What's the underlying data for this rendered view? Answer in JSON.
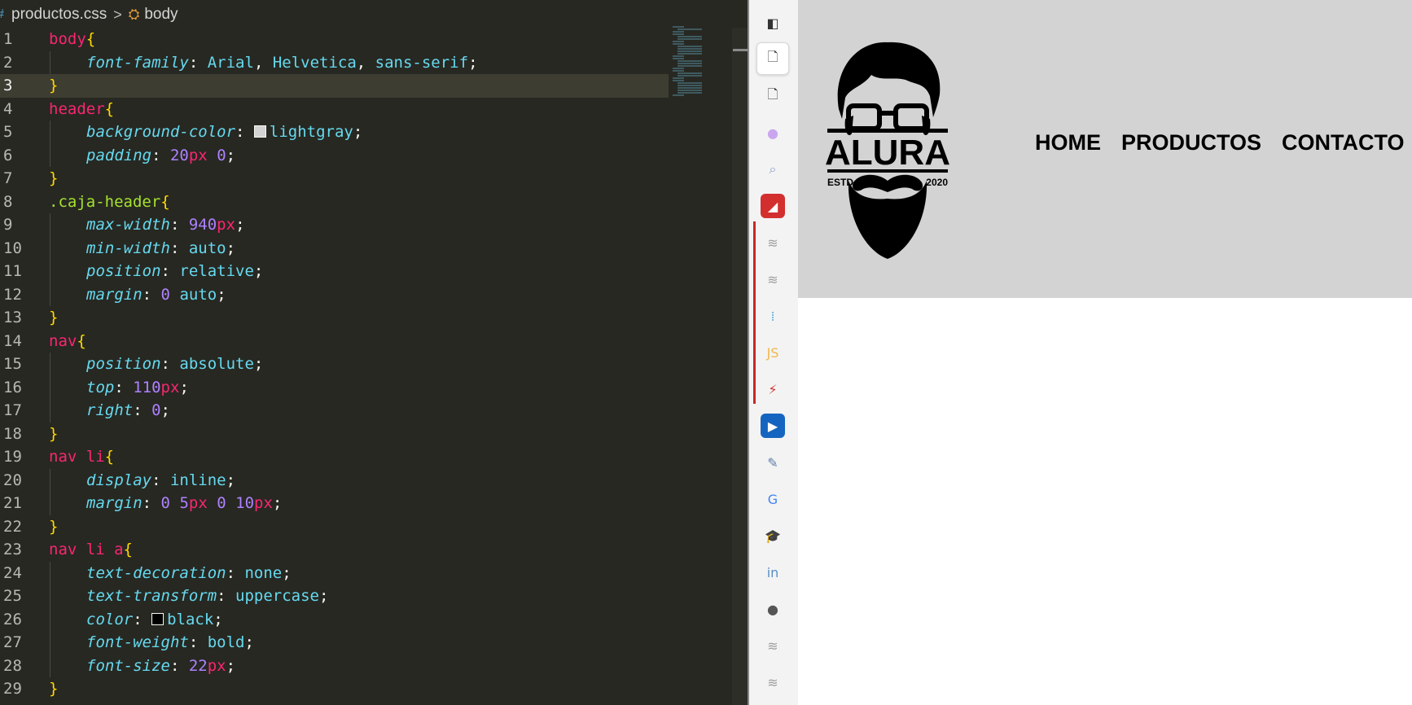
{
  "breadcrumb": {
    "file": "productos.css",
    "separator": ">",
    "symbol": "body"
  },
  "code": [
    {
      "n": "1",
      "tokens": [
        [
          "sel",
          "body"
        ],
        [
          "br",
          "{"
        ]
      ]
    },
    {
      "n": "2",
      "indent": true,
      "tokens": [
        [
          "prop",
          "font-family"
        ],
        [
          "pun",
          ": "
        ],
        [
          "val",
          "Arial"
        ],
        [
          "pun",
          ", "
        ],
        [
          "val",
          "Helvetica"
        ],
        [
          "pun",
          ", "
        ],
        [
          "val",
          "sans-serif"
        ],
        [
          "pun",
          ";"
        ]
      ]
    },
    {
      "n": "3",
      "active": true,
      "tokens": [
        [
          "br",
          "}"
        ]
      ]
    },
    {
      "n": "4",
      "tokens": [
        [
          "sel",
          "header"
        ],
        [
          "br",
          "{"
        ]
      ]
    },
    {
      "n": "5",
      "indent": true,
      "tokens": [
        [
          "prop",
          "background-color"
        ],
        [
          "pun",
          ": "
        ],
        [
          "swatch",
          "#d3d3d3"
        ],
        [
          "val",
          "lightgray"
        ],
        [
          "pun",
          ";"
        ]
      ]
    },
    {
      "n": "6",
      "indent": true,
      "tokens": [
        [
          "prop",
          "padding"
        ],
        [
          "pun",
          ": "
        ],
        [
          "num",
          "20"
        ],
        [
          "unit",
          "px"
        ],
        [
          "pun",
          " "
        ],
        [
          "num",
          "0"
        ],
        [
          "pun",
          ";"
        ]
      ]
    },
    {
      "n": "7",
      "tokens": [
        [
          "br",
          "}"
        ]
      ]
    },
    {
      "n": "8",
      "tokens": [
        [
          "cls",
          ".caja-header"
        ],
        [
          "br",
          "{"
        ]
      ]
    },
    {
      "n": "9",
      "indent": true,
      "tokens": [
        [
          "prop",
          "max-width"
        ],
        [
          "pun",
          ": "
        ],
        [
          "num",
          "940"
        ],
        [
          "unit",
          "px"
        ],
        [
          "pun",
          ";"
        ]
      ]
    },
    {
      "n": "10",
      "indent": true,
      "tokens": [
        [
          "prop",
          "min-width"
        ],
        [
          "pun",
          ": "
        ],
        [
          "val",
          "auto"
        ],
        [
          "pun",
          ";"
        ]
      ]
    },
    {
      "n": "11",
      "indent": true,
      "tokens": [
        [
          "prop",
          "position"
        ],
        [
          "pun",
          ": "
        ],
        [
          "val",
          "relative"
        ],
        [
          "pun",
          ";"
        ]
      ]
    },
    {
      "n": "12",
      "indent": true,
      "tokens": [
        [
          "prop",
          "margin"
        ],
        [
          "pun",
          ": "
        ],
        [
          "num",
          "0"
        ],
        [
          "pun",
          " "
        ],
        [
          "val",
          "auto"
        ],
        [
          "pun",
          ";"
        ]
      ]
    },
    {
      "n": "13",
      "tokens": [
        [
          "br",
          "}"
        ]
      ]
    },
    {
      "n": "14",
      "tokens": [
        [
          "sel",
          "nav"
        ],
        [
          "br",
          "{"
        ]
      ]
    },
    {
      "n": "15",
      "indent": true,
      "tokens": [
        [
          "prop",
          "position"
        ],
        [
          "pun",
          ": "
        ],
        [
          "val",
          "absolute"
        ],
        [
          "pun",
          ";"
        ]
      ]
    },
    {
      "n": "16",
      "indent": true,
      "tokens": [
        [
          "prop",
          "top"
        ],
        [
          "pun",
          ": "
        ],
        [
          "num",
          "110"
        ],
        [
          "unit",
          "px"
        ],
        [
          "pun",
          ";"
        ]
      ]
    },
    {
      "n": "17",
      "indent": true,
      "tokens": [
        [
          "prop",
          "right"
        ],
        [
          "pun",
          ": "
        ],
        [
          "num",
          "0"
        ],
        [
          "pun",
          ";"
        ]
      ]
    },
    {
      "n": "18",
      "tokens": [
        [
          "br",
          "}"
        ]
      ]
    },
    {
      "n": "19",
      "tokens": [
        [
          "sel",
          "nav li"
        ],
        [
          "br",
          "{"
        ]
      ]
    },
    {
      "n": "20",
      "indent": true,
      "tokens": [
        [
          "prop",
          "display"
        ],
        [
          "pun",
          ": "
        ],
        [
          "val",
          "inline"
        ],
        [
          "pun",
          ";"
        ]
      ]
    },
    {
      "n": "21",
      "indent": true,
      "tokens": [
        [
          "prop",
          "margin"
        ],
        [
          "pun",
          ": "
        ],
        [
          "num",
          "0"
        ],
        [
          "pun",
          " "
        ],
        [
          "num",
          "5"
        ],
        [
          "unit",
          "px"
        ],
        [
          "pun",
          " "
        ],
        [
          "num",
          "0"
        ],
        [
          "pun",
          " "
        ],
        [
          "num",
          "10"
        ],
        [
          "unit",
          "px"
        ],
        [
          "pun",
          ";"
        ]
      ]
    },
    {
      "n": "22",
      "tokens": [
        [
          "br",
          "}"
        ]
      ]
    },
    {
      "n": "23",
      "tokens": [
        [
          "sel",
          "nav li a"
        ],
        [
          "br",
          "{"
        ]
      ]
    },
    {
      "n": "24",
      "indent": true,
      "tokens": [
        [
          "prop",
          "text-decoration"
        ],
        [
          "pun",
          ": "
        ],
        [
          "val",
          "none"
        ],
        [
          "pun",
          ";"
        ]
      ]
    },
    {
      "n": "25",
      "indent": true,
      "tokens": [
        [
          "prop",
          "text-transform"
        ],
        [
          "pun",
          ": "
        ],
        [
          "val",
          "uppercase"
        ],
        [
          "pun",
          ";"
        ]
      ]
    },
    {
      "n": "26",
      "indent": true,
      "tokens": [
        [
          "prop",
          "color"
        ],
        [
          "pun",
          ": "
        ],
        [
          "swatch",
          "#000000"
        ],
        [
          "val",
          "black"
        ],
        [
          "pun",
          ";"
        ]
      ]
    },
    {
      "n": "27",
      "indent": true,
      "tokens": [
        [
          "prop",
          "font-weight"
        ],
        [
          "pun",
          ": "
        ],
        [
          "val",
          "bold"
        ],
        [
          "pun",
          ";"
        ]
      ]
    },
    {
      "n": "28",
      "indent": true,
      "tokens": [
        [
          "prop",
          "font-size"
        ],
        [
          "pun",
          ": "
        ],
        [
          "num",
          "22"
        ],
        [
          "unit",
          "px"
        ],
        [
          "pun",
          ";"
        ]
      ]
    },
    {
      "n": "29",
      "tokens": [
        [
          "br",
          "}"
        ]
      ]
    }
  ],
  "sidebar": [
    {
      "name": "layout-toggle-icon",
      "glyph": "◧",
      "color": "#333333"
    },
    {
      "name": "file-icon",
      "glyph": "🗋",
      "color": "#333333",
      "active": true
    },
    {
      "name": "file-outline-icon",
      "glyph": "🗋",
      "color": "#333333"
    },
    {
      "name": "extension-purple-icon",
      "glyph": "●",
      "color": "#c9a6ef"
    },
    {
      "name": "search-icon",
      "glyph": "⌕",
      "color": "#8aa0c8"
    },
    {
      "name": "red-app-icon",
      "glyph": "◢",
      "color": "#ffffff",
      "bg": "#d32f2f"
    },
    {
      "name": "aws-icon-1",
      "glyph": "≋",
      "color": "#9e9e9e"
    },
    {
      "name": "aws-icon-2",
      "glyph": "≋",
      "color": "#9e9e9e"
    },
    {
      "name": "cisco-icon",
      "glyph": "⁞",
      "color": "#5fb0d8"
    },
    {
      "name": "javascript-icon",
      "glyph": "JS",
      "color": "#f0b84a"
    },
    {
      "name": "tower-icon",
      "glyph": "⚡",
      "color": "#d32f2f"
    },
    {
      "name": "play-app-icon",
      "glyph": "▶",
      "color": "#ffffff",
      "bg": "#1565c0"
    },
    {
      "name": "notes-icon",
      "glyph": "✎",
      "color": "#5b7fa8"
    },
    {
      "name": "google-icon",
      "glyph": "G",
      "color": "#4285f4"
    },
    {
      "name": "education-icon",
      "glyph": "🎓",
      "color": "#e0b030"
    },
    {
      "name": "linkedin-icon",
      "glyph": "in",
      "color": "#5a8fc8"
    },
    {
      "name": "github-icon",
      "glyph": "●",
      "color": "#555555"
    },
    {
      "name": "aws-icon-3",
      "glyph": "≋",
      "color": "#9e9e9e"
    },
    {
      "name": "aws-icon-4",
      "glyph": "≋",
      "color": "#9e9e9e"
    }
  ],
  "site": {
    "logo": {
      "brand": "ALURA",
      "left_text": "ESTD",
      "right_text": "2020"
    },
    "nav": [
      "Home",
      "Productos",
      "Contacto"
    ]
  }
}
